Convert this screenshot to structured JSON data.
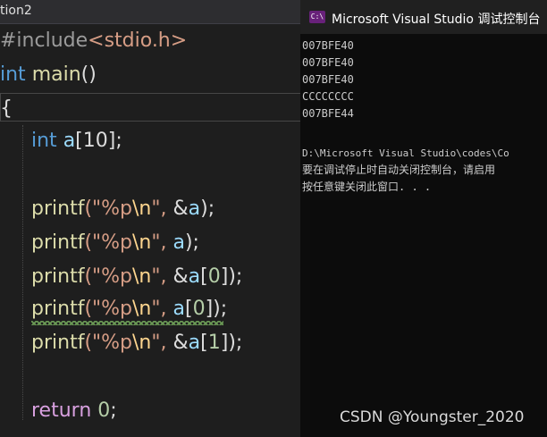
{
  "editor": {
    "tab_title": "tion2",
    "include": {
      "directive": "#include",
      "header": "<stdio.h>"
    },
    "main_sig": {
      "type": "int",
      "name": "main",
      "parens": "()"
    },
    "open_brace": "{",
    "decl": {
      "type": "int",
      "name": "a",
      "rest": "[10];"
    },
    "printf_lines": [
      {
        "fn": "printf",
        "open": "(\"",
        "fmt": "%p",
        "esc": "\\n",
        "close": "\", ",
        "amp": "&",
        "var": "a",
        "idx_open": "",
        "idx": "",
        "idx_close": "",
        "end": ");"
      },
      {
        "fn": "printf",
        "open": "(\"",
        "fmt": "%p",
        "esc": "\\n",
        "close": "\", ",
        "amp": "",
        "var": "a",
        "idx_open": "",
        "idx": "",
        "idx_close": "",
        "end": ");"
      },
      {
        "fn": "printf",
        "open": "(\"",
        "fmt": "%p",
        "esc": "\\n",
        "close": "\", ",
        "amp": "&",
        "var": "a",
        "idx_open": "[",
        "idx": "0",
        "idx_close": "]",
        "end": ");"
      },
      {
        "fn": "printf",
        "open": "(\"",
        "fmt": "%p",
        "esc": "\\n",
        "close": "\", ",
        "amp": "",
        "var": "a",
        "idx_open": "[",
        "idx": "0",
        "idx_close": "]",
        "end": ");"
      },
      {
        "fn": "printf",
        "open": "(\"",
        "fmt": "%p",
        "esc": "\\n",
        "close": "\", ",
        "amp": "&",
        "var": "a",
        "idx_open": "[",
        "idx": "1",
        "idx_close": "]",
        "end": ");"
      }
    ],
    "return_stmt": {
      "kw": "return",
      "value": "0",
      "end": ";"
    }
  },
  "console": {
    "title": "Microsoft Visual Studio 调试控制台",
    "icon": "console-app-icon",
    "output": [
      "007BFE40",
      "007BFE40",
      "007BFE40",
      "CCCCCCCC",
      "007BFE44"
    ],
    "path_line": "D:\\Microsoft Visual Studio\\codes\\Co",
    "info_line": "要在调试停止时自动关闭控制台，请启用",
    "prompt_line": "按任意键关闭此窗口. . ."
  },
  "watermark": "CSDN @Youngster_2020",
  "colors": {
    "keyword": "#569cd6",
    "function": "#dcdcaa",
    "string": "#d69d85",
    "variable": "#9cdcfe",
    "number": "#b5cea8",
    "return": "#d8a0df",
    "background": "#1e1e1e",
    "console_bg": "#0c0c0c"
  }
}
